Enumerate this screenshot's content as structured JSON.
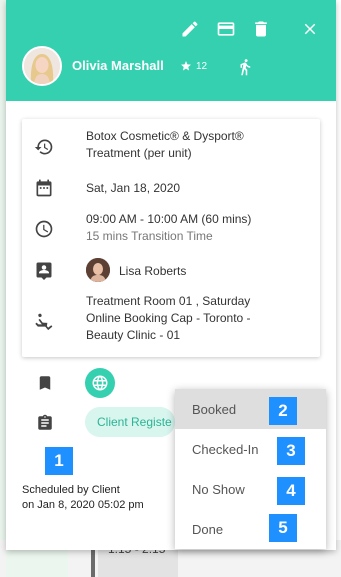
{
  "header": {
    "client_name": "Olivia Marshall",
    "loyalty_count": "12",
    "accent_color": "#35d0b0",
    "actions": [
      "edit-icon",
      "payment-card-icon",
      "delete-icon",
      "close-icon"
    ]
  },
  "appointment": {
    "service": "Botox Cosmetic® & Dysport® Treatment (per unit)",
    "service_line1": "Botox Cosmetic® & Dysport®",
    "service_line2": "Treatment (per unit)",
    "date": "Sat, Jan 18, 2020",
    "time": "09:00 AM - 10:00 AM (60 mins)",
    "transition": "15 mins Transition Time",
    "provider": "Lisa Roberts",
    "room_line1": "Treatment Room 01 , Saturday",
    "room_line2": "Online Booking Cap - Toronto -",
    "room_line3": "Beauty Clinic - 01"
  },
  "tag": {
    "label": "Client Registe"
  },
  "scheduled": {
    "line1": "Scheduled by Client",
    "line2": "on Jan 8, 2020 05:02 pm"
  },
  "status_menu": {
    "items": [
      {
        "label": "Booked",
        "selected": true,
        "badge": "2"
      },
      {
        "label": "Checked-In",
        "selected": false,
        "badge": "3"
      },
      {
        "label": "No Show",
        "selected": false,
        "badge": "4"
      },
      {
        "label": "Done",
        "selected": false,
        "badge": "5"
      }
    ]
  },
  "badges": {
    "one": "1"
  },
  "background": {
    "calendar_slot": "1:15 - 2:15"
  }
}
